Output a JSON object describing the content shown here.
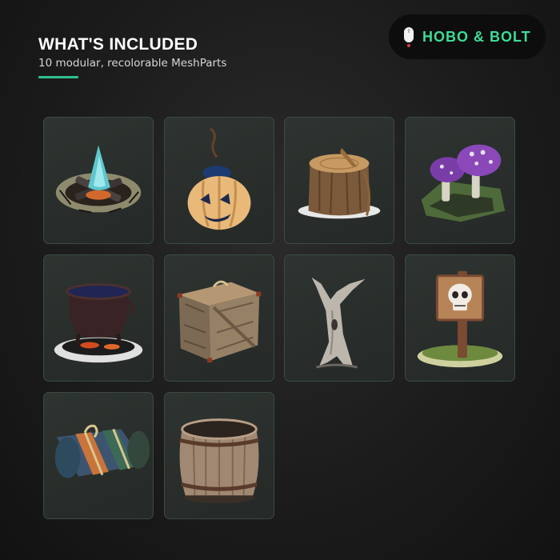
{
  "header": {
    "title": "WHAT'S INCLUDED",
    "subtitle": "10 modular, recolorable MeshParts"
  },
  "brand": {
    "name": "HOBO & BOLT",
    "icon": "mouse-icon"
  },
  "accent_color": "#2fbf8f",
  "brand_color": "#3ddc97",
  "items": [
    {
      "icon": "campfire-icon"
    },
    {
      "icon": "pumpkin-bomb-icon"
    },
    {
      "icon": "tree-stump-icon"
    },
    {
      "icon": "mushrooms-icon"
    },
    {
      "icon": "cauldron-icon"
    },
    {
      "icon": "wooden-crate-icon"
    },
    {
      "icon": "dead-tree-icon"
    },
    {
      "icon": "skull-sign-icon"
    },
    {
      "icon": "bedroll-icon"
    },
    {
      "icon": "barrel-icon"
    }
  ]
}
